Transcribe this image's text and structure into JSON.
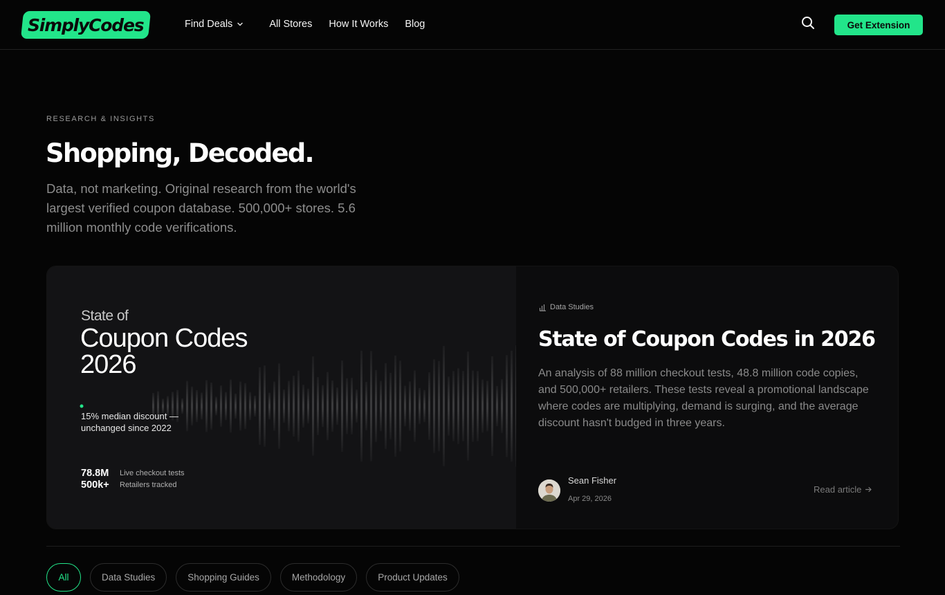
{
  "header": {
    "logo_text": "SimplyCodes",
    "nav": [
      {
        "label": "Find Deals",
        "has_dropdown": true
      },
      {
        "label": "All Stores"
      },
      {
        "label": "How It Works"
      },
      {
        "label": "Blog"
      }
    ],
    "search_icon": "search-icon",
    "cta_label": "Get Extension"
  },
  "hero": {
    "eyebrow": "RESEARCH & INSIGHTS",
    "title": "Shopping, Decoded.",
    "subtitle": "Data, not marketing. Original research from the world's largest verified coupon database. 500,000+ stores. 5.6 million monthly code verifications."
  },
  "featured": {
    "visual": {
      "kicker": "State of",
      "title": "Coupon Codes 2026",
      "note": "15% median discount — unchanged since 2022",
      "stats": [
        {
          "value": "78.8M",
          "label": "Live checkout tests"
        },
        {
          "value": "500k+",
          "label": "Retailers tracked"
        }
      ],
      "accent": "#22e58a"
    },
    "category": "Data Studies",
    "category_icon": "bar-chart-icon",
    "title": "State of Coupon Codes in 2026",
    "description": "An analysis of 88 million checkout tests, 48.8 million code copies, and 500,000+ retailers. These tests reveal a promotional landscape where codes are multiplying, demand is surging, and the average discount hasn't budged in three years.",
    "author": "Sean Fisher",
    "date": "Apr 29, 2026",
    "read_label": "Read article",
    "read_icon": "arrow-right-icon"
  },
  "filters": {
    "items": [
      "All",
      "Data Studies",
      "Shopping Guides",
      "Methodology",
      "Product Updates"
    ],
    "active": "All"
  },
  "colors": {
    "accent": "#22e58a",
    "background": "#050505",
    "card": "#0c0c0d"
  }
}
